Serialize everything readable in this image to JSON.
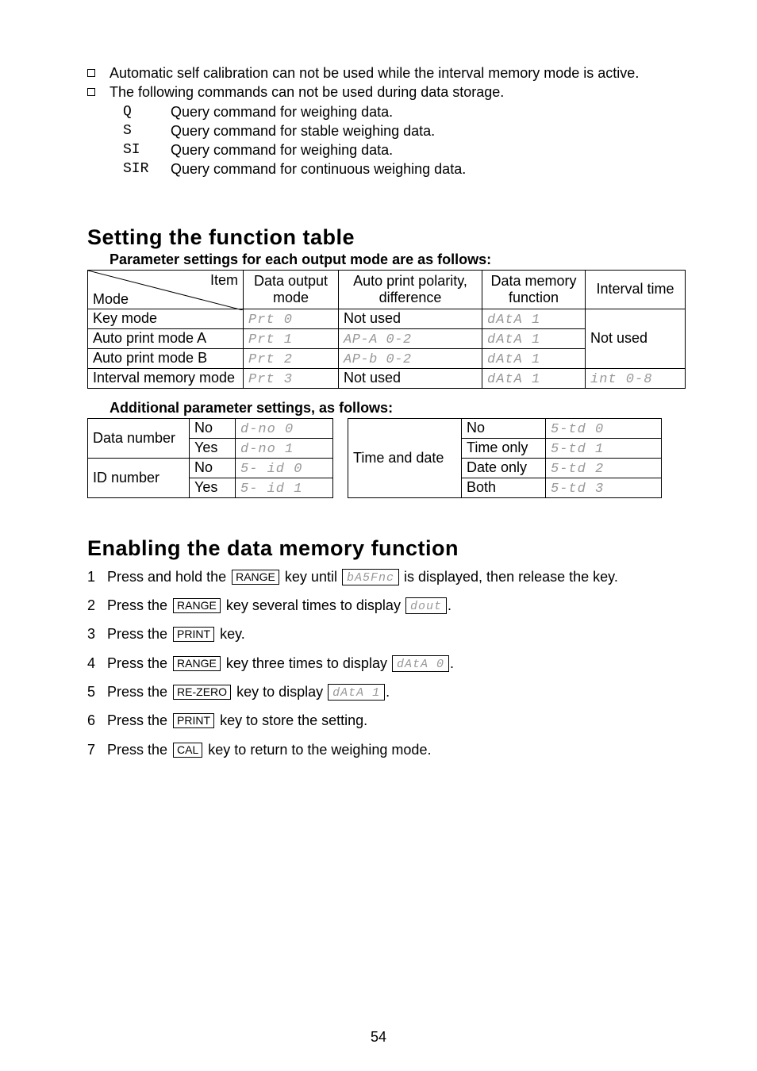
{
  "bullets": {
    "b1": "Automatic self calibration can not be used while the interval memory mode is active.",
    "b2": "The following commands can not be used during data storage.",
    "sub": [
      {
        "code": "Q",
        "text": "Query command for weighing data."
      },
      {
        "code": "S",
        "text": "Query command for stable weighing data."
      },
      {
        "code": "SI",
        "text": "Query command for weighing data."
      },
      {
        "code": "SIR",
        "text": "Query command for continuous weighing data."
      }
    ]
  },
  "section1": {
    "title": "Setting the function table",
    "caption": "Parameter settings for each output mode are as follows:",
    "header": {
      "itemLabel": "Item",
      "modeLabel": "Mode",
      "col2a": "Data output",
      "col2b": "mode",
      "col3a": "Auto print polarity,",
      "col3b": "difference",
      "col4a": "Data memory",
      "col4b": "function",
      "col5": "Interval time"
    },
    "rows": [
      {
        "label": "Key mode",
        "c2": "Prt 0",
        "c3": "Not used",
        "c4": "dAtA 1"
      },
      {
        "label": "Auto print mode A",
        "c2": "Prt 1",
        "c3": "AP-A 0-2",
        "c4": "dAtA 1"
      },
      {
        "label": "Auto print mode B",
        "c2": "Prt 2",
        "c3": "AP-b 0-2",
        "c4": "dAtA 1"
      },
      {
        "label": "Interval memory mode",
        "c2": "Prt 3",
        "c3": "Not used",
        "c4": "dAtA 1"
      }
    ],
    "intervalNotUsed": "Not used",
    "intervalUsed": "int 0-8"
  },
  "section2": {
    "caption": "Additional parameter settings, as follows:",
    "left": {
      "r1": "Data number",
      "r2": "ID number",
      "cells": [
        {
          "a": "No",
          "b": "d-no 0"
        },
        {
          "a": "Yes",
          "b": "d-no 1"
        },
        {
          "a": "No",
          "b": "5- id 0"
        },
        {
          "a": "Yes",
          "b": "5- id 1"
        }
      ]
    },
    "right": {
      "label": "Time and date",
      "cells": [
        {
          "a": "No",
          "b": "5-td 0"
        },
        {
          "a": "Time only",
          "b": "5-td 1"
        },
        {
          "a": "Date only",
          "b": "5-td 2"
        },
        {
          "a": "Both",
          "b": "5-td 3"
        }
      ]
    }
  },
  "section3": {
    "title": "Enabling the data memory function",
    "steps": {
      "s1a": "Press and hold the ",
      "s1b": " key until ",
      "s1c": " is displayed, then release the key.",
      "s1_lcd": "bA5Fnc",
      "s2a": "Press the ",
      "s2b": " key several times to display ",
      "s2_lcd": "dout",
      "s3a": "Press the ",
      "s3b": " key.",
      "s4a": "Press the ",
      "s4b": " key three times to display ",
      "s4_lcd": "dAtA 0",
      "s5a": "Press the ",
      "s5b": " key to display ",
      "s5_lcd": "dAtA 1",
      "s6a": "Press the ",
      "s6b": " key to store the setting.",
      "s7a": "Press the ",
      "s7b": " key to return to the weighing mode."
    },
    "keys": {
      "range": "RANGE",
      "print": "PRINT",
      "rezero": "RE-ZERO",
      "cal": "CAL"
    }
  },
  "pageNumber": "54"
}
